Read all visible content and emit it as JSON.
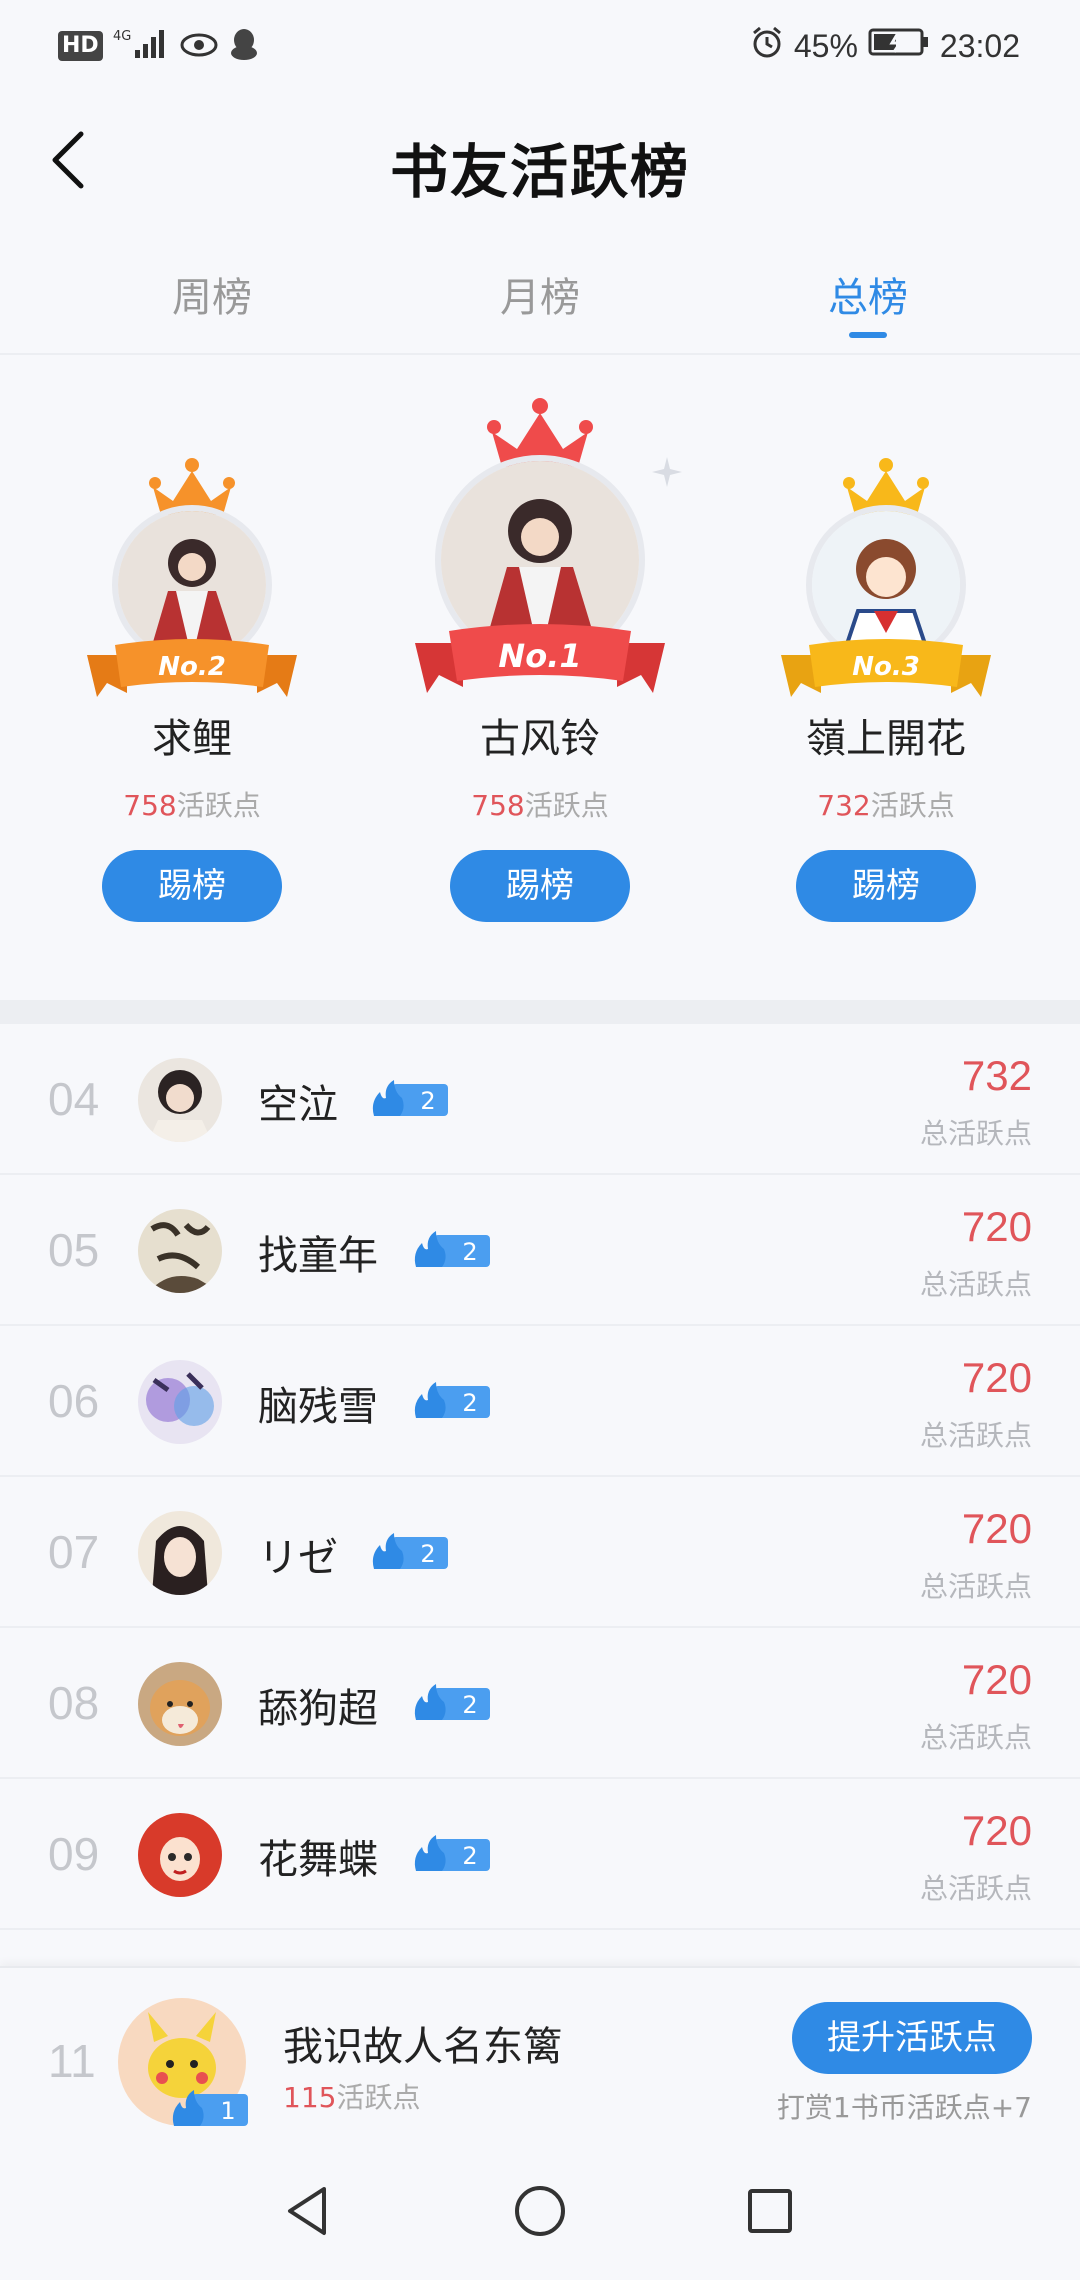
{
  "status_bar": {
    "hd": "HD",
    "network": "4G",
    "battery": "45%",
    "time": "23:02"
  },
  "header": {
    "title": "书友活跃榜"
  },
  "tabs": [
    {
      "label": "周榜",
      "active": false
    },
    {
      "label": "月榜",
      "active": false
    },
    {
      "label": "总榜",
      "active": true
    }
  ],
  "podium": [
    {
      "rank_label": "No.2",
      "name": "求鲤",
      "points": "758",
      "points_suffix": "活跃点",
      "button": "踢榜",
      "crown_color": "#f6922a"
    },
    {
      "rank_label": "No.1",
      "name": "古风铃",
      "points": "758",
      "points_suffix": "活跃点",
      "button": "踢榜",
      "crown_color": "#ef4b4b"
    },
    {
      "rank_label": "No.3",
      "name": "嶺上開花",
      "points": "732",
      "points_suffix": "活跃点",
      "button": "踢榜",
      "crown_color": "#f8b81a"
    }
  ],
  "rank_list": [
    {
      "rank": "04",
      "name": "空泣",
      "level": "2",
      "points": "732",
      "points_label": "总活跃点"
    },
    {
      "rank": "05",
      "name": "找童年",
      "level": "2",
      "points": "720",
      "points_label": "总活跃点"
    },
    {
      "rank": "06",
      "name": "脑残雪",
      "level": "2",
      "points": "720",
      "points_label": "总活跃点"
    },
    {
      "rank": "07",
      "name": "リゼ",
      "level": "2",
      "points": "720",
      "points_label": "总活跃点"
    },
    {
      "rank": "08",
      "name": "舔狗超",
      "level": "2",
      "points": "720",
      "points_label": "总活跃点"
    },
    {
      "rank": "09",
      "name": "花舞蝶",
      "level": "2",
      "points": "720",
      "points_label": "总活跃点"
    }
  ],
  "self": {
    "rank": "11",
    "name": "我识故人名东篱",
    "level": "1",
    "points": "115",
    "points_suffix": "活跃点",
    "boost_button": "提升活跃点",
    "reward_hint": "打赏1书币活跃点+7"
  },
  "colors": {
    "accent": "#2f8ae5",
    "points_red": "#e0555a"
  }
}
